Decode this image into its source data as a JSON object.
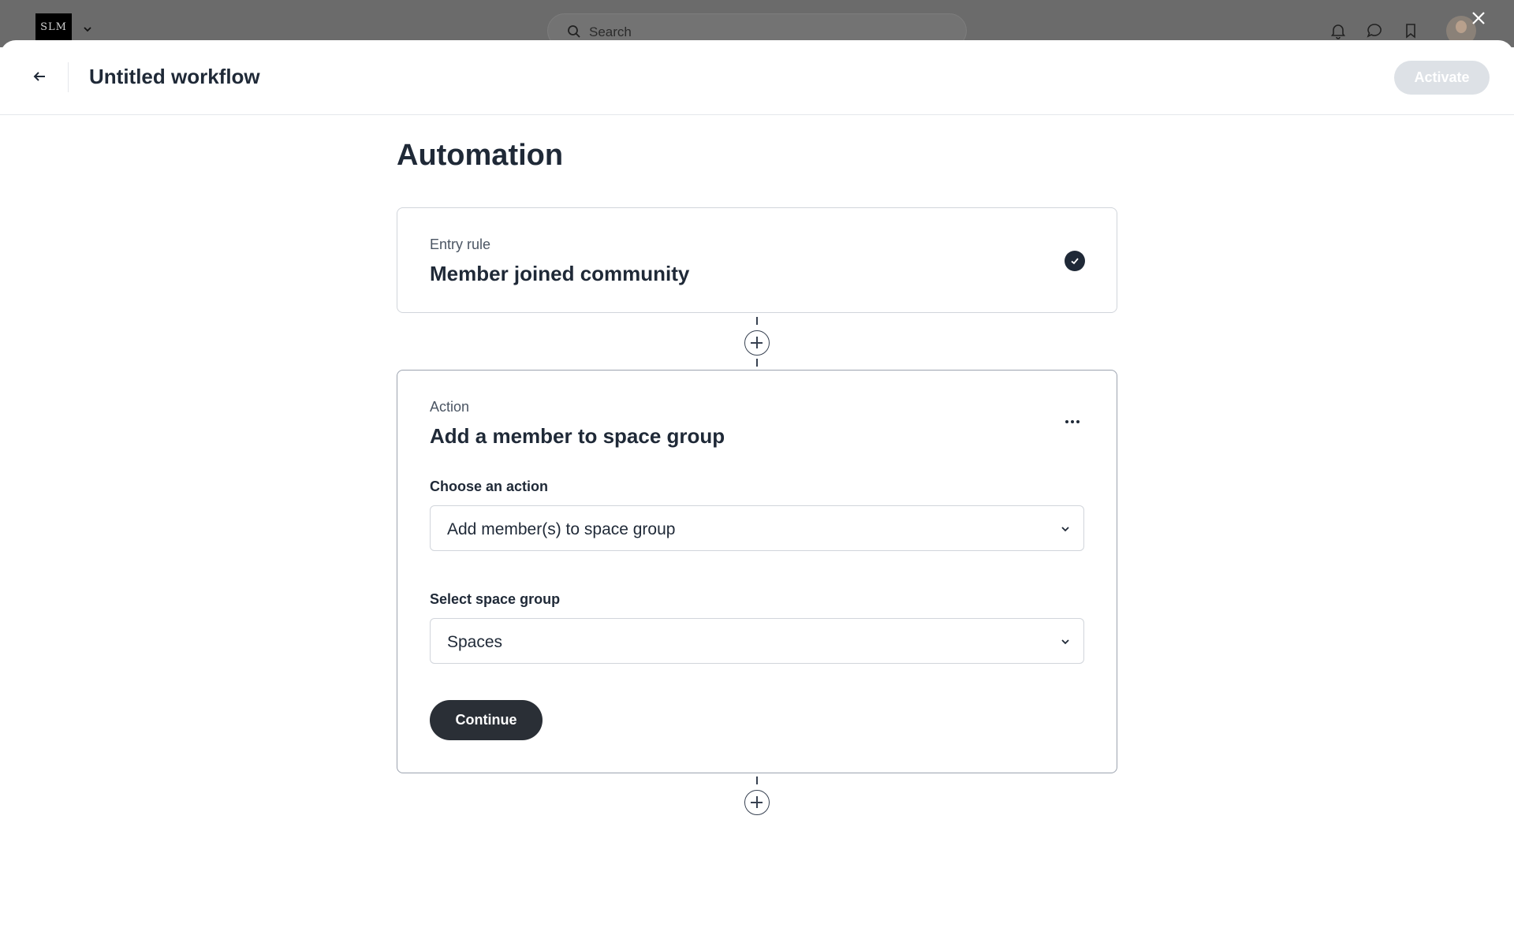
{
  "background_bar": {
    "logo_text": "SLM",
    "search_placeholder": "Search"
  },
  "header": {
    "title": "Untitled workflow",
    "activate_label": "Activate"
  },
  "page": {
    "heading": "Automation"
  },
  "entry_card": {
    "kicker": "Entry rule",
    "title": "Member joined community"
  },
  "action_card": {
    "kicker": "Action",
    "title": "Add a member to space group",
    "choose_action_label": "Choose an action",
    "choose_action_value": "Add member(s) to space group",
    "space_group_label": "Select space group",
    "space_group_value": "Spaces",
    "continue_label": "Continue"
  },
  "colors": {
    "primary_dark": "#2a2f36",
    "disabled_button": "#dde1e6",
    "overlay_bar": "#6b6b6b"
  }
}
